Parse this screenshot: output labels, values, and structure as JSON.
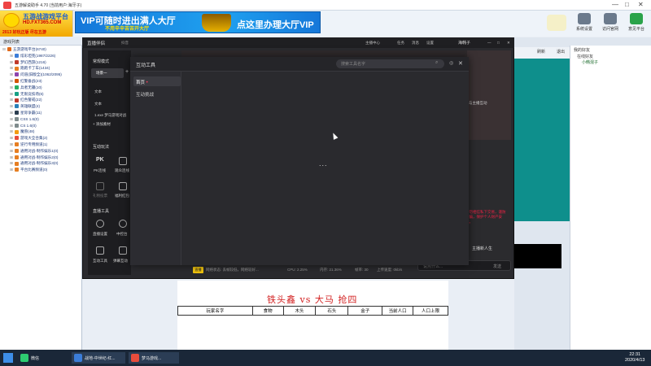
{
  "app": {
    "title": "五游解说助手 4.70 (当前用户:海牙子)",
    "controls": [
      "—",
      "□",
      "✕"
    ]
  },
  "logo": {
    "name": "五游战游戏平台",
    "site": "HD.FXT365.COM",
    "slogan": "2013 好玩正版 尽在五游"
  },
  "vip_ad": {
    "text1": "VIP可随时进出满人大厅",
    "text2": "不用辛辛苦苦开大厅",
    "text3": "点这里办理大厅VIP"
  },
  "top_buttons": [
    {
      "label": "系统设置"
    },
    {
      "label": "访问官网"
    },
    {
      "label": "意见平台"
    }
  ],
  "tree": {
    "header": "游戏列表",
    "items": [
      {
        "label": "五游游戏平台(6740)",
        "color": "#e06a1a"
      },
      {
        "label": "炫彩坦克(1987/2226)",
        "color": "#3b7dd8"
      },
      {
        "label": "梦幻西游(1216)",
        "color": "#c0392b"
      },
      {
        "label": "跑跑卡丁车(1434)",
        "color": "#e67e22"
      },
      {
        "label": "问道(旧版全)(1062/2095)",
        "color": "#8e44ad"
      },
      {
        "label": "红警备战(23)",
        "color": "#d35400"
      },
      {
        "label": "兵者无疆(10)",
        "color": "#27ae60"
      },
      {
        "label": "无限竞技场(6)",
        "color": "#16a085"
      },
      {
        "label": "红色警戒(22)",
        "color": "#c0392b"
      },
      {
        "label": "英雄联盟(4)",
        "color": "#2980b9"
      },
      {
        "label": "星际争霸(11)",
        "color": "#2c3e50"
      },
      {
        "label": "CSS 1.6(0)",
        "color": "#7f8c8d"
      },
      {
        "label": "CS 1.6(0)",
        "color": "#7f8c8d"
      },
      {
        "label": "魔兽(48)",
        "color": "#f39c12"
      },
      {
        "label": "游戏大全合集(2)",
        "color": "#e74c3c"
      },
      {
        "label": "逆行专用频道(1)",
        "color": "#e67e22"
      },
      {
        "label": "通用对战-制作娱乐1(0)",
        "color": "#e67e22"
      },
      {
        "label": "通用对战-制作娱乐2(0)",
        "color": "#e67e22"
      },
      {
        "label": "通用对战-制作娱乐3(0)",
        "color": "#e67e22"
      },
      {
        "label": "平台比赛频道(0)",
        "color": "#e67e22"
      }
    ]
  },
  "right_toolbar": [
    "刷新",
    "退出"
  ],
  "right_list": {
    "header": "我的好友",
    "group": "在线好友",
    "item": "小韩混子"
  },
  "obs": {
    "title": "直播伴侣",
    "subtitle": "抖音",
    "top_items": [
      "主播中心",
      "任务",
      "消息",
      "设置"
    ],
    "user": "海韩子",
    "mode_label": "常规模式",
    "scene": "场景一",
    "sources": [
      "文本",
      "文本",
      "1.exe 梦马游戏对战"
    ],
    "add_source": "+ 添加素材",
    "interactive_section": "互动玩法",
    "interactive_items": [
      "PK连线",
      "观众连线",
      "礼物投票",
      "福利红包"
    ],
    "live_tools_section": "直播工具",
    "live_tools": [
      "直播设置",
      "弹幕互动",
      "互动工具",
      "观众抽奖",
      "中控台",
      "进入评论"
    ],
    "status": {
      "badge": "直播",
      "cpu": "CPU: 2.25%",
      "mem": "内存: 21.36%",
      "rate": "帧率: 30",
      "upload": "上传速度: 0kb/s",
      "msg": "网络状态: 丢帧较低，网络较好..."
    },
    "right_text1": "与主播互动",
    "red_text": "请勿相信私下交易，谨防受骗，保护个人财产安全。",
    "guest": "主播新人生",
    "chat_placeholder": "说点什么...",
    "send": "发送"
  },
  "dialog": {
    "title": "互动工具",
    "search_placeholder": "搜索工具名字",
    "tabs": [
      "首页",
      "互动挑战"
    ],
    "loading": "..."
  },
  "sheet": {
    "match_title": "铁头鑫 vs 大马 抢四",
    "columns": [
      "玩家名字",
      "食物",
      "木头",
      "石头",
      "金子",
      "当前人口",
      "人口上限"
    ]
  },
  "taskbar": {
    "items": [
      {
        "label": "微信",
        "color": "#2ecc71"
      },
      {
        "label": "战地-中世纪-红...",
        "color": "#3b7dd8"
      },
      {
        "label": "梦马游戏...",
        "color": "#e74c3c"
      }
    ],
    "time": "22:31",
    "date": "2020/4/13"
  }
}
